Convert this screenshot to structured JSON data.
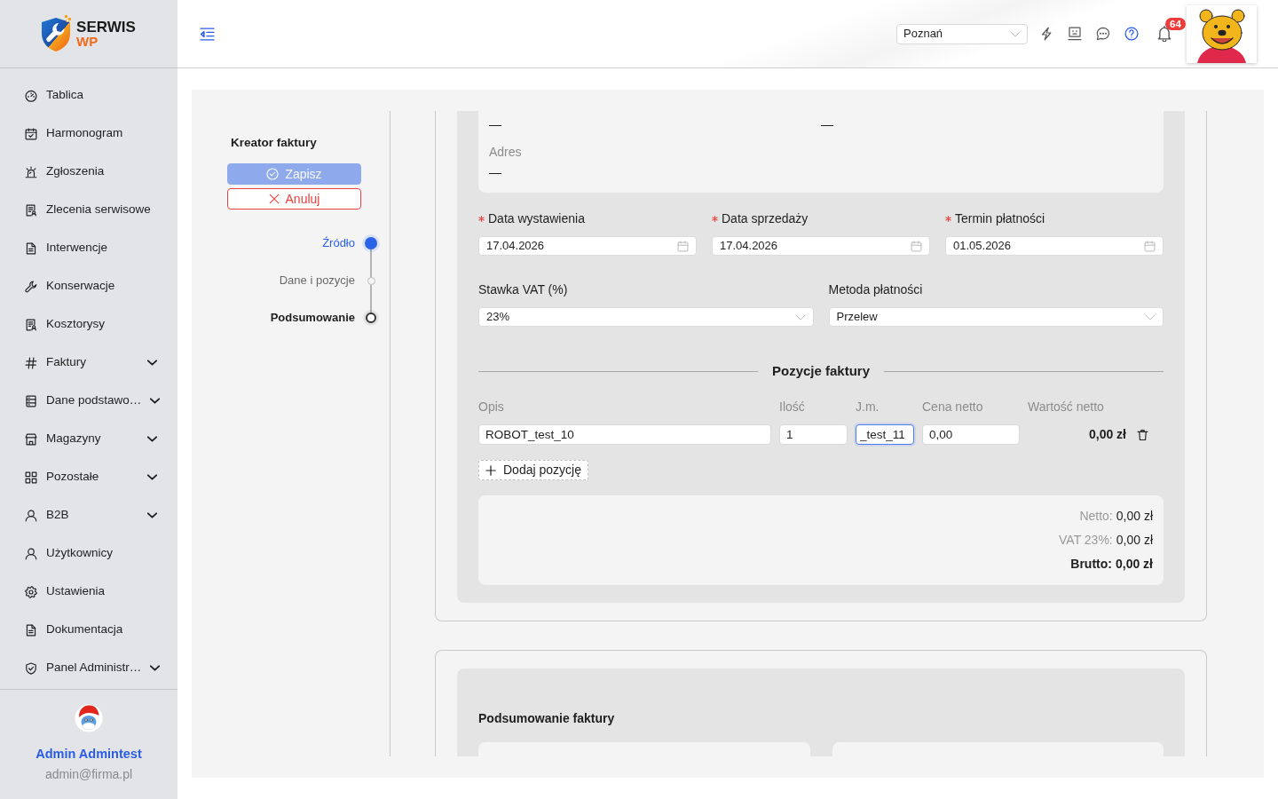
{
  "logo": {
    "name": "SERWIS",
    "suffix": "WP"
  },
  "sidebar": {
    "items": [
      {
        "label": "Tablica",
        "expandable": false
      },
      {
        "label": "Harmonogram",
        "expandable": false
      },
      {
        "label": "Zgłoszenia",
        "expandable": false
      },
      {
        "label": "Zlecenia serwisowe",
        "expandable": false
      },
      {
        "label": "Interwencje",
        "expandable": false
      },
      {
        "label": "Konserwacje",
        "expandable": false
      },
      {
        "label": "Kosztorysy",
        "expandable": false
      },
      {
        "label": "Faktury",
        "expandable": true
      },
      {
        "label": "Dane podstawo…",
        "expandable": true
      },
      {
        "label": "Magazyny",
        "expandable": true
      },
      {
        "label": "Pozostałe",
        "expandable": true
      },
      {
        "label": "B2B",
        "expandable": true
      },
      {
        "label": "Użytkownicy",
        "expandable": false
      },
      {
        "label": "Ustawienia",
        "expandable": false
      },
      {
        "label": "Dokumentacja",
        "expandable": false
      },
      {
        "label": "Panel Administr…",
        "expandable": true
      }
    ],
    "user": {
      "name": "Admin Admintest",
      "email": "admin@firma.pl"
    }
  },
  "header": {
    "location": {
      "value": "Poznań"
    },
    "notifications": {
      "count": "64"
    }
  },
  "wizard": {
    "title": "Kreator faktury",
    "buttons": [
      {
        "kind": "save",
        "label": "Zapisz",
        "disabled": true
      },
      {
        "kind": "cancel",
        "label": "Anuluj",
        "disabled": false
      }
    ],
    "steps": [
      {
        "label": "Źródło",
        "selected": true,
        "highlighted": false
      },
      {
        "label": "Dane i pozycje",
        "selected": false,
        "highlighted": false
      },
      {
        "label": "Podsumowanie",
        "selected": false,
        "highlighted": true
      }
    ]
  },
  "details": {
    "partial_row": [
      "—",
      "—"
    ],
    "address": {
      "label": "Adres",
      "value": "—"
    }
  },
  "dates": [
    {
      "label": "Data wystawienia",
      "required": true,
      "value": "17.04.2026"
    },
    {
      "label": "Data sprzedaży",
      "required": true,
      "value": "17.04.2026"
    },
    {
      "label": "Termin płatności",
      "required": true,
      "value": "01.05.2026"
    }
  ],
  "vat_rate": {
    "label": "Stawka VAT (%)",
    "value": "23%"
  },
  "payment_method": {
    "label": "Metoda płatności",
    "value": "Przelew"
  },
  "items_section": {
    "title": "Pozycje faktury",
    "columns": [
      "Opis",
      "Ilość",
      "J.m.",
      "Cena netto",
      "Wartość netto"
    ],
    "rows": [
      {
        "description": {
          "value": "ROBOT_test_10",
          "focused": false
        },
        "quantity": {
          "value": "1",
          "focused": false
        },
        "unit": {
          "value": "_test_11",
          "focused": true
        },
        "net_price": {
          "value": "0,00",
          "focused": false
        },
        "net_value": "0,00 zł"
      }
    ],
    "add_button": {
      "label": "Dodaj pozycję"
    }
  },
  "totals": [
    {
      "kind": "subtotal",
      "label": "Netto:",
      "value": "0,00 zł"
    },
    {
      "kind": "subtotal",
      "label": "VAT 23%:",
      "value": "0,00 zł"
    },
    {
      "kind": "total",
      "label": "Brutto:",
      "value": "0,00 zł"
    }
  ],
  "summary_section": {
    "title": "Podsumowanie faktury"
  }
}
